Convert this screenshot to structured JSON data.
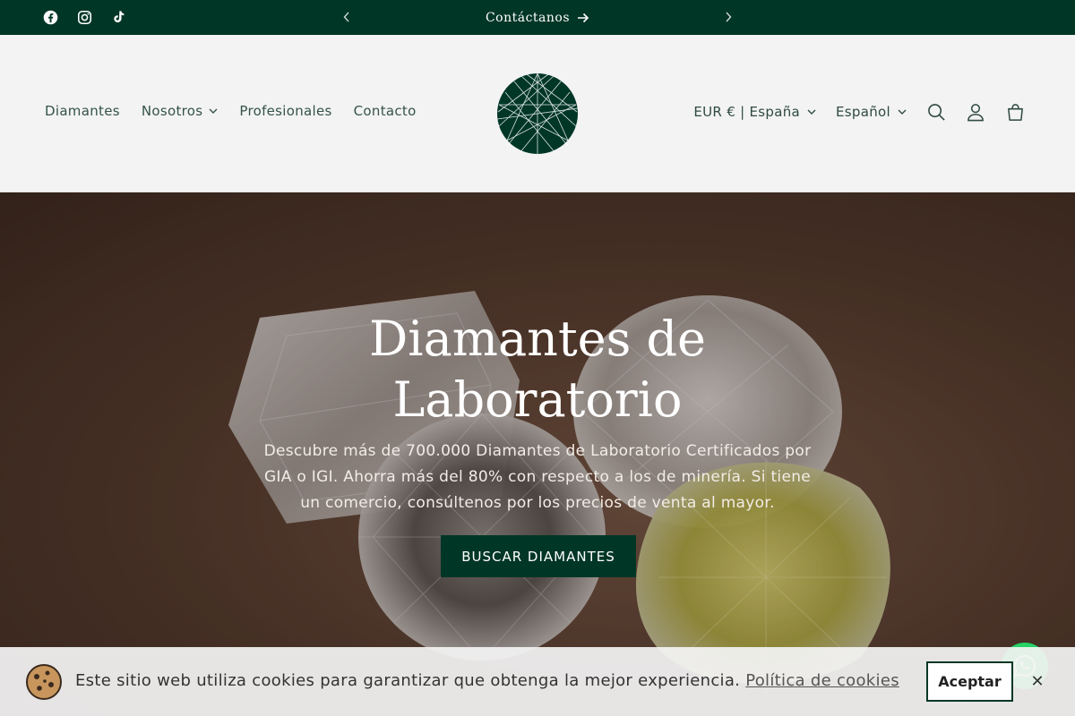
{
  "announcement": {
    "text": "Contáctanos",
    "arrow_icon": "arrow-right-icon",
    "prev_icon": "chevron-left-icon",
    "next_icon": "chevron-right-icon"
  },
  "social": {
    "items": [
      {
        "icon": "facebook-icon"
      },
      {
        "icon": "instagram-icon"
      },
      {
        "icon": "tiktok-icon"
      }
    ]
  },
  "nav": {
    "items": [
      {
        "label": "Diamantes"
      },
      {
        "label": "Nosotros",
        "has_dropdown": true
      },
      {
        "label": "Profesionales"
      },
      {
        "label": "Contacto"
      }
    ]
  },
  "header": {
    "currency": "EUR € | España",
    "language": "Español",
    "icons": [
      "search-icon",
      "account-icon",
      "cart-icon"
    ]
  },
  "hero": {
    "title": "Diamantes de Laboratorio",
    "subtitle": "Descubre más de 700.000 Diamantes de Laboratorio Certificados por GIA o IGI. Ahorra más del 80% con respecto a los de minería. Si tiene un comercio, consúltenos por los precios de venta al mayor.",
    "button": "BUSCAR DIAMANTES"
  },
  "cookie": {
    "text": "Este sitio web utiliza cookies para garantizar que obtenga la mejor experiencia.",
    "link": "Política de cookies",
    "accept": "Aceptar",
    "close": "✕"
  },
  "colors": {
    "brand": "#003626",
    "background": "#f3f3f3"
  }
}
